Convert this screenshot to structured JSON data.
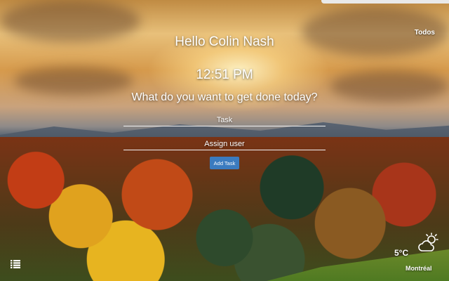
{
  "header": {
    "todos_link": "Todos"
  },
  "greeting": "Hello Colin Nash",
  "clock": "12:51 PM",
  "prompt": "What do you want to get done today?",
  "form": {
    "task_placeholder": "Task",
    "task_value": "",
    "assign_placeholder": "Assign user",
    "assign_value": "",
    "add_button_label": "Add Task",
    "button_color": "#3b7bbf"
  },
  "weather": {
    "temperature": "5°C",
    "city": "Montréal",
    "icon": "partly-cloudy-icon"
  },
  "icons": {
    "menu": "list-icon"
  }
}
